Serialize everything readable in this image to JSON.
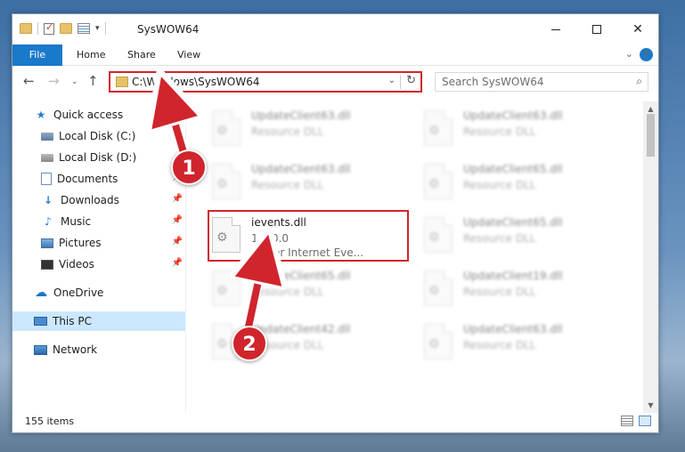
{
  "window": {
    "title": "SysWOW64"
  },
  "ribbon": {
    "tabs": [
      "File",
      "Home",
      "Share",
      "View"
    ]
  },
  "address": {
    "path": "C:\\Windows\\SysWOW64"
  },
  "search": {
    "placeholder": "Search SysWOW64"
  },
  "sidebar": {
    "items": [
      {
        "label": "Quick access",
        "icon": "star-icon"
      },
      {
        "label": "Local Disk (C:)",
        "icon": "drive-icon"
      },
      {
        "label": "Local Disk (D:)",
        "icon": "drive-icon"
      },
      {
        "label": "Documents",
        "icon": "documents-icon"
      },
      {
        "label": "Downloads",
        "icon": "download-icon"
      },
      {
        "label": "Music",
        "icon": "music-icon"
      },
      {
        "label": "Pictures",
        "icon": "pictures-icon"
      },
      {
        "label": "Videos",
        "icon": "videos-icon"
      },
      {
        "label": "OneDrive",
        "icon": "cloud-icon"
      },
      {
        "label": "This PC",
        "icon": "computer-icon"
      },
      {
        "label": "Network",
        "icon": "network-icon"
      }
    ]
  },
  "files": [
    {
      "name": "UpdateClient63.dll",
      "line2": "Resource DLL",
      "line3": ""
    },
    {
      "name": "UpdateClient63.dll",
      "line2": "Resource DLL",
      "line3": ""
    },
    {
      "name": "UpdateClient63.dll",
      "line2": "Resource DLL",
      "line3": ""
    },
    {
      "name": "UpdateClient65.dll",
      "line2": "Resource DLL",
      "line3": ""
    },
    {
      "name": "ievents.dll",
      "line2": "1.1.0.0",
      "line3": "Girder Internet Eve..."
    },
    {
      "name": "UpdateClient65.dll",
      "line2": "Resource DLL",
      "line3": ""
    },
    {
      "name": "UpdateClient65.dll",
      "line2": "Resource DLL",
      "line3": ""
    },
    {
      "name": "UpdateClient19.dll",
      "line2": "Resource DLL",
      "line3": ""
    },
    {
      "name": "UpdateClient42.dll",
      "line2": "Resource DLL",
      "line3": ""
    },
    {
      "name": "UpdateClient63.dll",
      "line2": "Resource DLL",
      "line3": ""
    }
  ],
  "status": {
    "count": "155 items"
  },
  "annotations": {
    "step1": "1",
    "step2": "2"
  },
  "colors": {
    "accent": "#1979ca",
    "highlight": "#d0252c",
    "selected": "#cce8ff"
  }
}
